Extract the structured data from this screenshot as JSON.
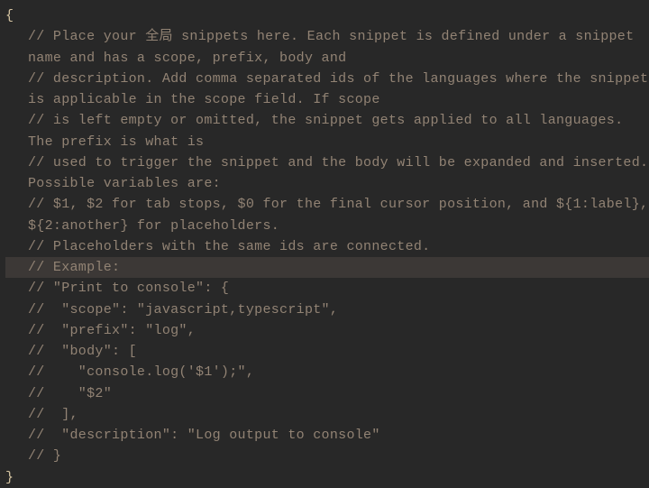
{
  "code": {
    "open_brace": "{",
    "close_brace": "}",
    "lines": [
      "// Place your 全局 snippets here. Each snippet is defined under a snippet name and has a scope, prefix, body and",
      "// description. Add comma separated ids of the languages where the snippet is applicable in the scope field. If scope",
      "// is left empty or omitted, the snippet gets applied to all languages. The prefix is what is",
      "// used to trigger the snippet and the body will be expanded and inserted. Possible variables are:",
      "// $1, $2 for tab stops, $0 for the final cursor position, and ${1:label}, ${2:another} for placeholders.",
      "// Placeholders with the same ids are connected.",
      "// Example:",
      "// \"Print to console\": {",
      "//  \"scope\": \"javascript,typescript\",",
      "//  \"prefix\": \"log\",",
      "//  \"body\": [",
      "//    \"console.log('$1');\",",
      "//    \"$2\"",
      "//  ],",
      "//  \"description\": \"Log output to console\"",
      "// }"
    ],
    "highlighted_line_index": 6
  }
}
